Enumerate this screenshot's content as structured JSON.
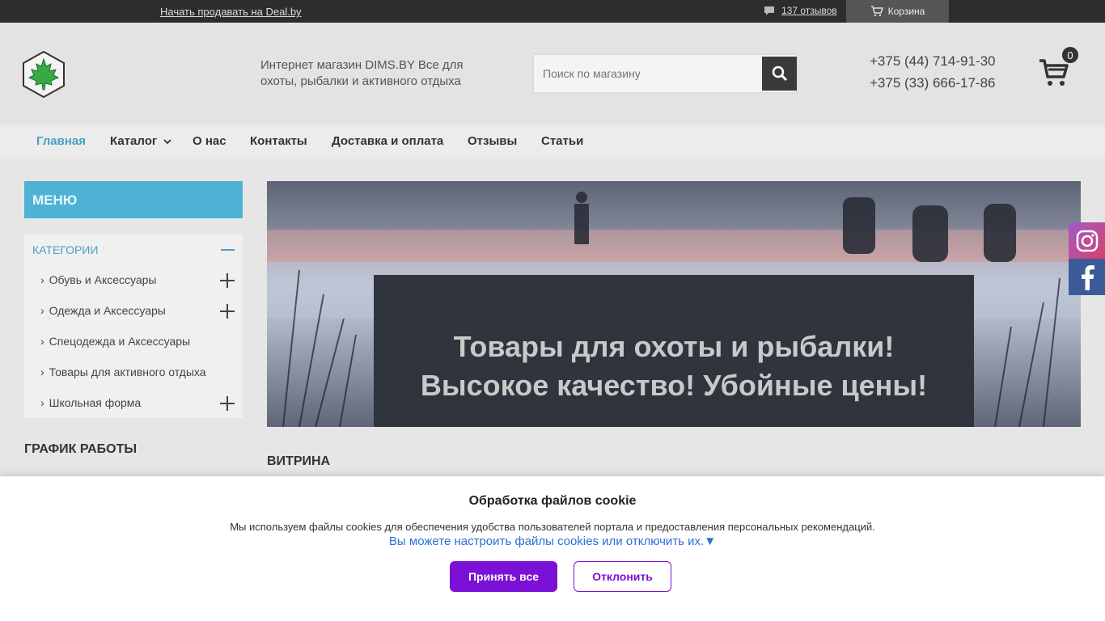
{
  "topbar": {
    "sell_link": "Начать продавать на Deal.by",
    "reviews_link": "137 отзывов",
    "cart_label": "Корзина"
  },
  "header": {
    "tagline": "Интернет магазин DIMS.BY Все для охоты, рыбалки и активного отдыха",
    "search_placeholder": "Поиск по магазину",
    "phone1": "+375 (44) 714-91-30",
    "phone2": "+375 (33) 666-17-86",
    "cart_count": "0"
  },
  "nav": {
    "items": [
      "Главная",
      "Каталог",
      "О нас",
      "Контакты",
      "Доставка и оплата",
      "Отзывы",
      "Статьи"
    ]
  },
  "sidebar": {
    "menu_title": "МЕНЮ",
    "categories_title": "КАТЕГОРИИ",
    "categories": [
      "Обувь и Аксессуары",
      "Одежда и Аксессуары",
      "Спецодежда и Аксессуары",
      "Товары для активного отдыха",
      "Школьная форма"
    ],
    "schedule_title": "ГРАФИК РАБОТЫ"
  },
  "banner": {
    "line1": "Товары для охоты и рыбалки!",
    "line2": "Высокое качество! Убойные цены!"
  },
  "main": {
    "section_title": "ВИТРИНА"
  },
  "cookie": {
    "title": "Обработка файлов cookie",
    "text": "Мы используем файлы cookies для обеспечения удобства пользователей портала и предоставления персональных рекомендаций.",
    "link": "Вы можете настроить файлы cookies или отключить их.▼",
    "accept": "Принять все",
    "decline": "Отклонить"
  },
  "colors": {
    "accent": "#4db2d4",
    "cookie_button": "#7b10d6",
    "topbar": "#2d2d2d"
  },
  "icons": [
    "maple-leaf-logo",
    "comment-icon",
    "cart-icon",
    "search-icon",
    "chevron-down-icon",
    "instagram-icon",
    "facebook-icon"
  ]
}
